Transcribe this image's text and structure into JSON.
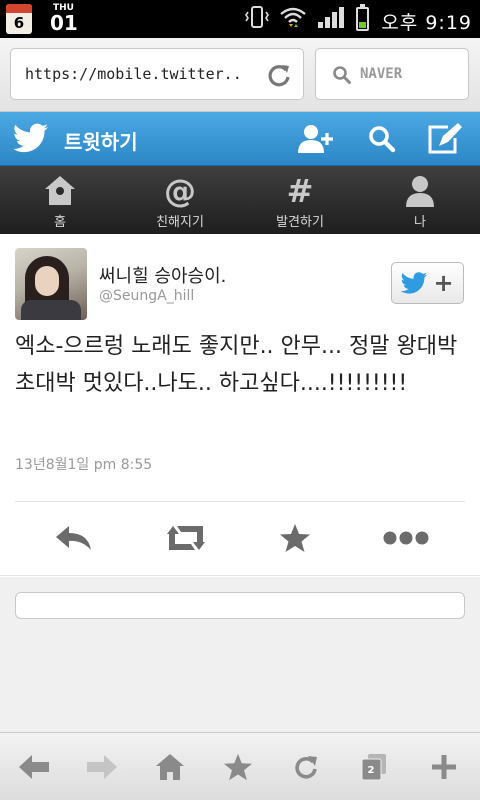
{
  "status_bar": {
    "calendar_number": "6",
    "day": "THU",
    "date": "01",
    "time": "오후 9:19",
    "icons": [
      "vibrate-icon",
      "wifi-icon",
      "signal-icon",
      "battery-icon"
    ]
  },
  "browser": {
    "url": "https://mobile.twitter..",
    "search_placeholder": "NAVER",
    "tabs_count": "2"
  },
  "header": {
    "title": "트윗하기",
    "color": "#3a97d6"
  },
  "tabs": [
    {
      "label": "홈",
      "icon": "home-icon"
    },
    {
      "label": "친해지기",
      "icon": "at-icon",
      "glyph": "@"
    },
    {
      "label": "발견하기",
      "icon": "hashtag-icon",
      "glyph": "#"
    },
    {
      "label": "나",
      "icon": "person-icon"
    }
  ],
  "tweet": {
    "display_name": "써니힐 승아승이.",
    "screen_name": "@SeungA_hill",
    "text": "엑소-으르렁 노래도 좋지만.. 안무... 정말 왕대박초대박 멋있다..나도.. 하고싶다....!!!!!!!!!",
    "timestamp": "13년8월1일 pm 8:55"
  }
}
